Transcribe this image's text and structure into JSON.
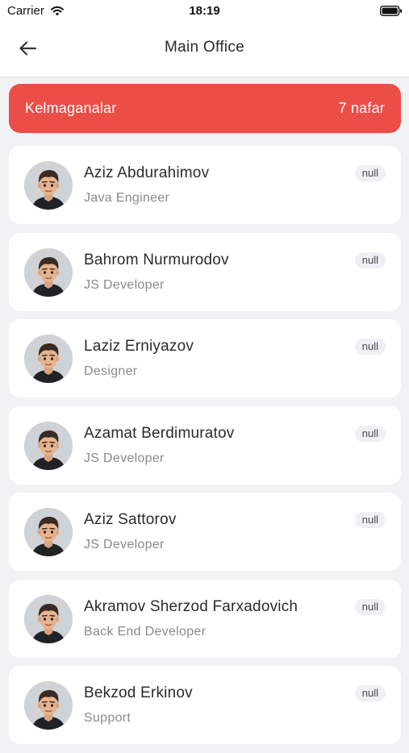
{
  "status_bar": {
    "carrier": "Carrier",
    "time": "18:19"
  },
  "header": {
    "title": "Main Office",
    "back_icon": "arrow-left-icon"
  },
  "banner": {
    "label": "Kelmaganalar",
    "count": "7 nafar",
    "color": "#ea4e47"
  },
  "employees": [
    {
      "name": "Aziz Abdurahimov",
      "role": "Java Engineer",
      "status": "null"
    },
    {
      "name": "Bahrom Nurmurodov",
      "role": "JS Developer",
      "status": "null"
    },
    {
      "name": "Laziz Erniyazov",
      "role": "Designer",
      "status": "null"
    },
    {
      "name": "Azamat Berdimuratov",
      "role": "JS Developer",
      "status": "null"
    },
    {
      "name": "Aziz Sattorov",
      "role": "JS Developer",
      "status": "null"
    },
    {
      "name": "Akramov Sherzod Farxadovich",
      "role": "Back End Developer",
      "status": "null"
    },
    {
      "name": "Bekzod Erkinov",
      "role": "Support",
      "status": "null"
    }
  ]
}
